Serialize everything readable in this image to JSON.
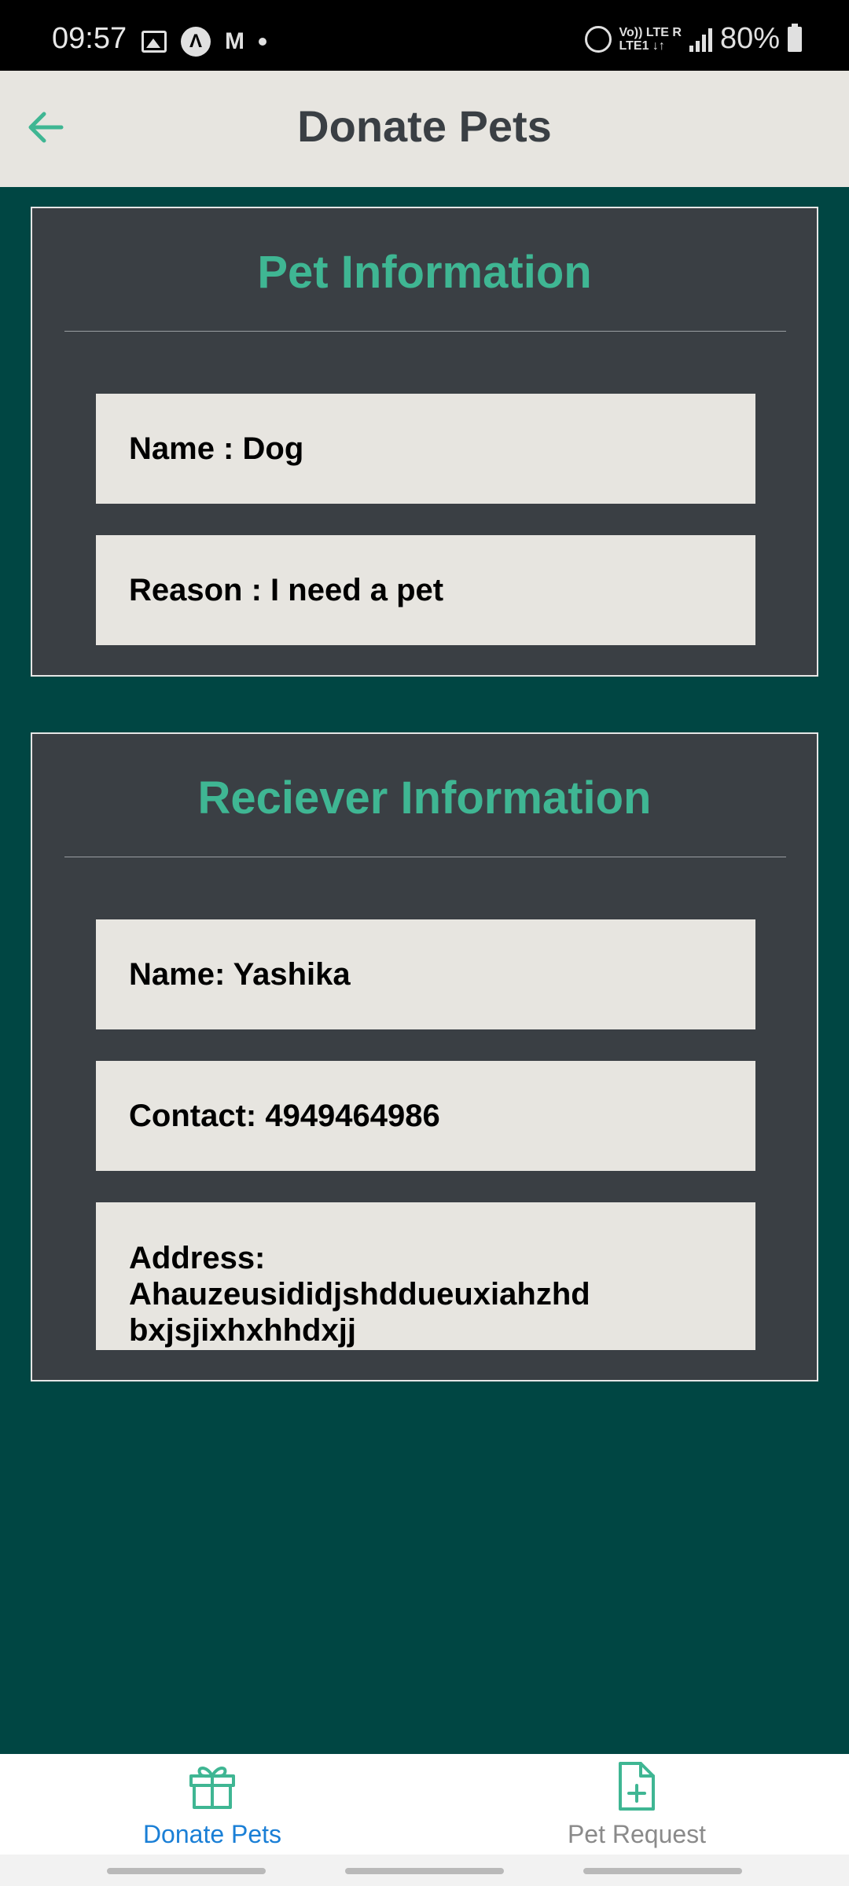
{
  "status_bar": {
    "time": "09:57",
    "network_line1": "Vo)) LTE R",
    "network_line2": "LTE1 ↓↑",
    "battery": "80%"
  },
  "app_bar": {
    "title": "Donate Pets",
    "back_icon": "arrow-left-icon"
  },
  "pet_info": {
    "title": "Pet Information",
    "name": "Name : Dog",
    "reason": "Reason : I need a pet"
  },
  "receiver_info": {
    "title": "Reciever Information",
    "name": "Name: Yashika",
    "contact": "Contact: 4949464986",
    "address_line1": "Address: Ahauzeusididjshddueuxiahzhd",
    "address_line2": "bxjsjixhxhhdxjj"
  },
  "bottom_nav": {
    "items": [
      {
        "label": "Donate Pets",
        "icon": "gift-icon",
        "active": true
      },
      {
        "label": "Pet Request",
        "icon": "file-plus-icon",
        "active": false
      }
    ]
  },
  "colors": {
    "background": "#004643",
    "card": "#3a3f44",
    "accent": "#3fb693",
    "field": "#e7e5e0",
    "nav_active": "#1a7fd6"
  }
}
